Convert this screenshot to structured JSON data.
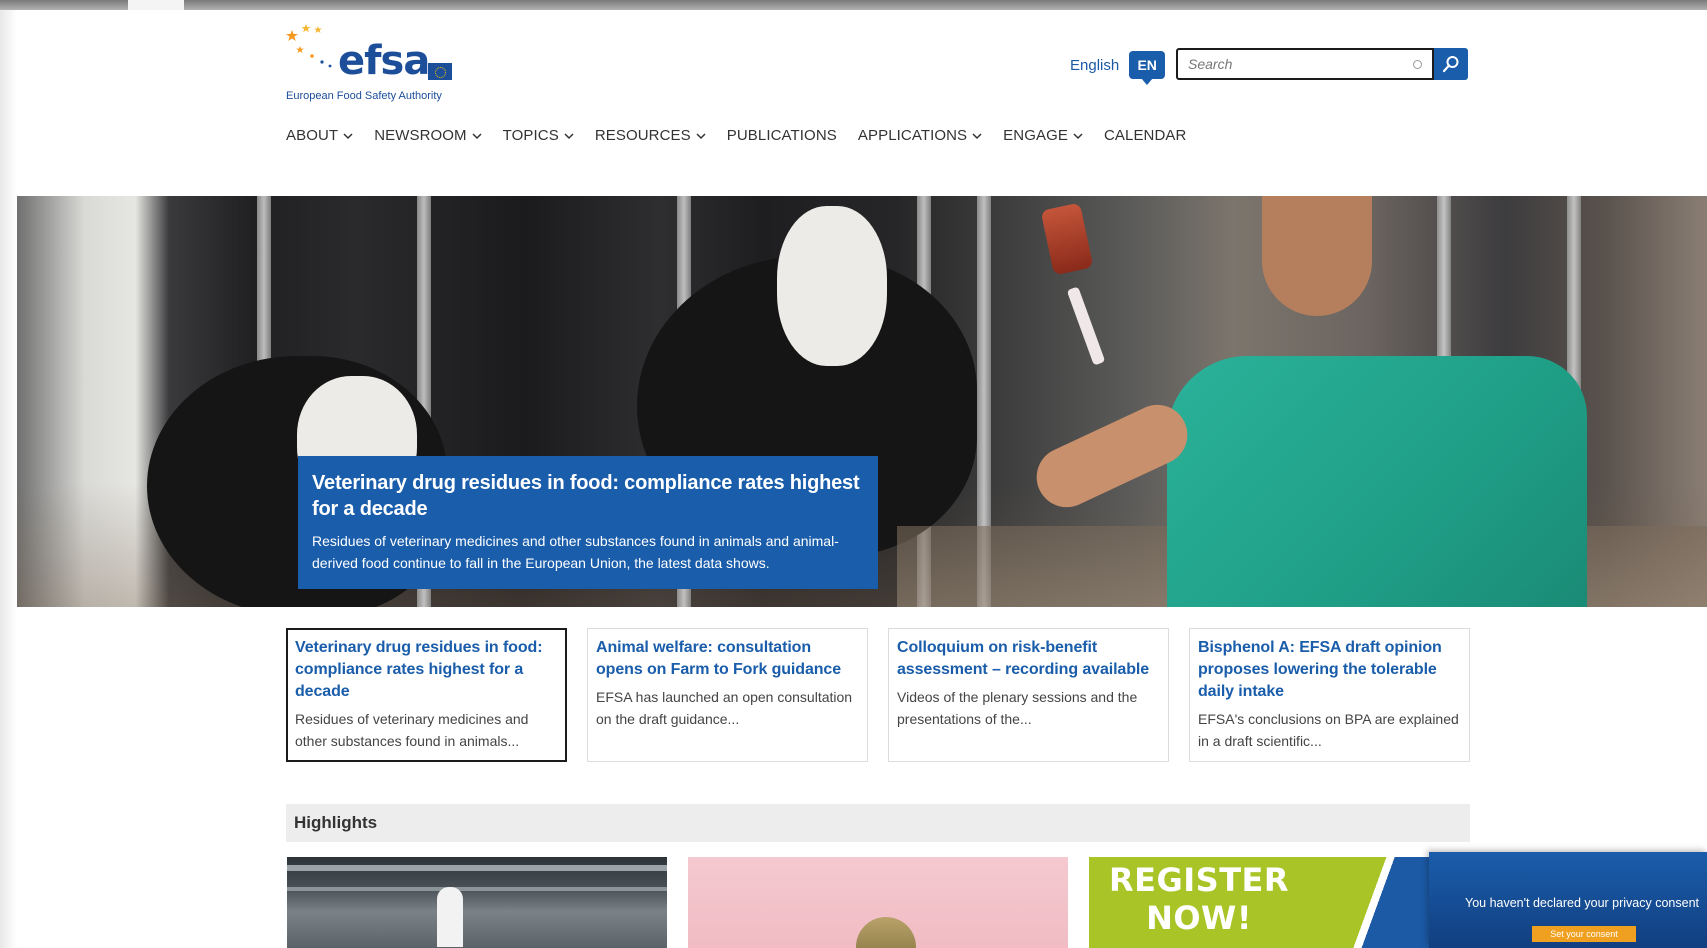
{
  "header": {
    "logo": {
      "wordmark": "efsa",
      "tagline": "European Food Safety Authority"
    },
    "language": {
      "label": "English",
      "code": "EN"
    },
    "search": {
      "placeholder": "Search",
      "value": ""
    },
    "nav": [
      {
        "label": "ABOUT",
        "has_dropdown": true
      },
      {
        "label": "NEWSROOM",
        "has_dropdown": true
      },
      {
        "label": "TOPICS",
        "has_dropdown": true
      },
      {
        "label": "RESOURCES",
        "has_dropdown": true
      },
      {
        "label": "PUBLICATIONS",
        "has_dropdown": false
      },
      {
        "label": "APPLICATIONS",
        "has_dropdown": true
      },
      {
        "label": "ENGAGE",
        "has_dropdown": true
      },
      {
        "label": "CALENDAR",
        "has_dropdown": false
      }
    ]
  },
  "hero": {
    "title": "Veterinary drug residues in food: compliance rates highest for a decade",
    "text": "Residues of veterinary medicines and other substances found in animals and animal-derived food continue to fall in the European Union, the latest data shows."
  },
  "cards": [
    {
      "title": "Veterinary drug residues in food: compliance rates highest for a decade",
      "text": "Residues of veterinary medicines and other substances found in animals...",
      "active": true
    },
    {
      "title": "Animal welfare: consultation opens on Farm to Fork guidance",
      "text": "EFSA has launched an open consultation on the draft guidance...",
      "active": false
    },
    {
      "title": "Colloquium on risk-benefit assessment – recording available",
      "text": "Videos of the plenary sessions and the presentations of the...",
      "active": false
    },
    {
      "title": "Bisphenol A: EFSA draft opinion proposes lowering the tolerable daily intake",
      "text": "EFSA's conclusions on BPA are explained in a draft scientific...",
      "active": false
    }
  ],
  "highlights": {
    "title": "Highlights",
    "register_text": "REGISTER NOW!"
  },
  "consent": {
    "text": "You haven't declared your privacy consent",
    "button": "Set your consent"
  },
  "colors": {
    "brand_blue": "#1a5dab",
    "accent_green": "#a9c427",
    "consent_button": "#f0a020"
  }
}
